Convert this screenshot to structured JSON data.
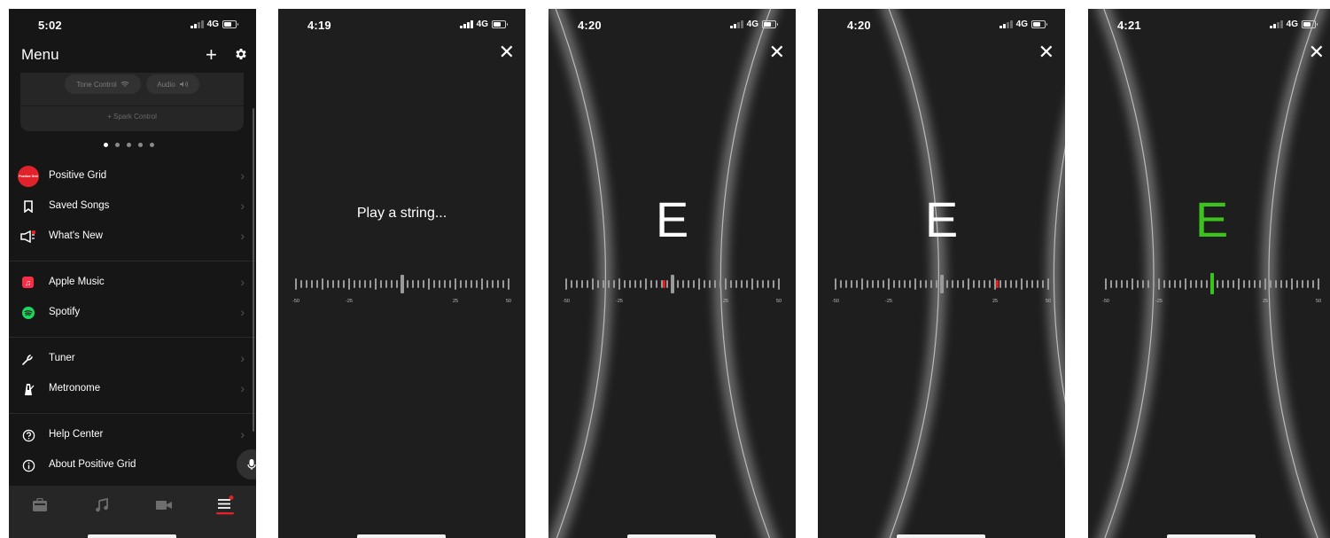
{
  "menu_screen": {
    "status": {
      "time": "5:02",
      "network": "4G"
    },
    "title": "Menu",
    "header_icons": [
      "plus-icon",
      "gear-icon"
    ],
    "card": {
      "chips": [
        {
          "label": "Tone Control",
          "icon": "wifi-icon"
        },
        {
          "label": "Audio",
          "icon": "speaker-icon"
        }
      ],
      "spark_control": "+ Spark Control"
    },
    "page_dots": 5,
    "active_dot": 0,
    "groups": [
      [
        {
          "label": "Positive Grid",
          "icon": "positive-grid-logo",
          "logo_text": "Positive Grid",
          "color": "#e0232a"
        },
        {
          "label": "Saved Songs",
          "icon": "bookmark-icon"
        },
        {
          "label": "What's New",
          "icon": "megaphone-icon",
          "badge": true
        }
      ],
      [
        {
          "label": "Apple Music",
          "icon": "apple-music-icon",
          "color": "#fa2d48"
        },
        {
          "label": "Spotify",
          "icon": "spotify-icon",
          "color": "#1ed760"
        }
      ],
      [
        {
          "label": "Tuner",
          "icon": "tuning-fork-icon"
        },
        {
          "label": "Metronome",
          "icon": "metronome-icon"
        }
      ],
      [
        {
          "label": "Help Center",
          "icon": "help-icon"
        },
        {
          "label": "About Positive Grid",
          "icon": "info-icon"
        }
      ]
    ],
    "tabs": [
      "amp-icon",
      "music-icon",
      "video-icon",
      "menu-icon"
    ],
    "active_tab": 3,
    "accent": "#e0232a"
  },
  "tuner_screens": [
    {
      "time": "4:19",
      "network": "4G",
      "prompt": "Play a string...",
      "note": "",
      "state": "idle",
      "signal_bars": 4
    },
    {
      "time": "4:20",
      "network": "4G",
      "note": "E",
      "state": "flat",
      "needle_cents": -4,
      "needle_color": "#e02020",
      "signal_bars": 2
    },
    {
      "time": "4:20",
      "network": "4G",
      "note": "E",
      "state": "sharp",
      "needle_cents": 26,
      "needle_color": "#e02020",
      "signal_bars": 2
    },
    {
      "time": "4:21",
      "network": "4G",
      "note": "E",
      "state": "in-tune",
      "needle_cents": 0,
      "needle_color": "#3cc31e",
      "note_color": "#3cc31e",
      "signal_bars": 2
    }
  ],
  "scale_labels": [
    "-50",
    "-25",
    "25",
    "50"
  ]
}
